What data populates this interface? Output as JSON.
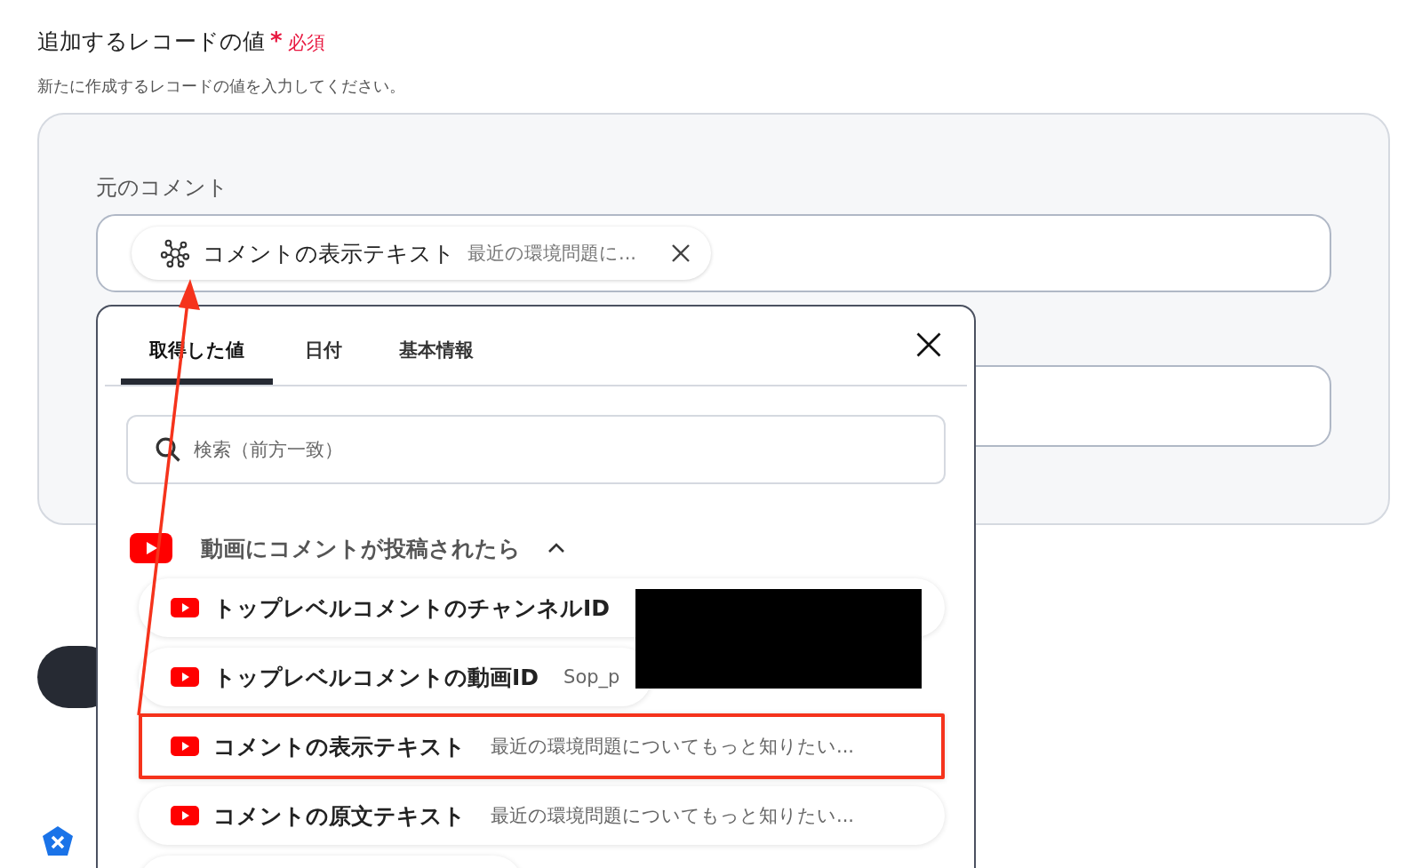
{
  "section": {
    "title": "追加するレコードの値",
    "required_mark": "*",
    "required_label": "必須",
    "description": "新たに作成するレコードの値を入力してください。"
  },
  "field": {
    "label": "元のコメント",
    "chip": {
      "name": "コメントの表示テキスト",
      "value": "最近の環境問題に..."
    }
  },
  "popup": {
    "tabs": [
      {
        "label": "取得した値",
        "selected": true
      },
      {
        "label": "日付",
        "selected": false
      },
      {
        "label": "基本情報",
        "selected": false
      }
    ],
    "search": {
      "placeholder": "検索（前方一致）"
    },
    "group": {
      "title": "動画にコメントが投稿されたら",
      "expanded": true
    },
    "items": [
      {
        "name": "トップレベルコメントのチャンネルID",
        "value": "",
        "redacted": true,
        "highlighted": false
      },
      {
        "name": "トップレベルコメントの動画ID",
        "value": "Sop_p",
        "redacted": false,
        "highlighted": false
      },
      {
        "name": "コメントの表示テキスト",
        "value": "最近の環境問題についてもっと知りたい...",
        "redacted": false,
        "highlighted": true
      },
      {
        "name": "コメントの原文テキスト",
        "value": "最近の環境問題についてもっと知りたい...",
        "redacted": false,
        "highlighted": false
      }
    ]
  }
}
